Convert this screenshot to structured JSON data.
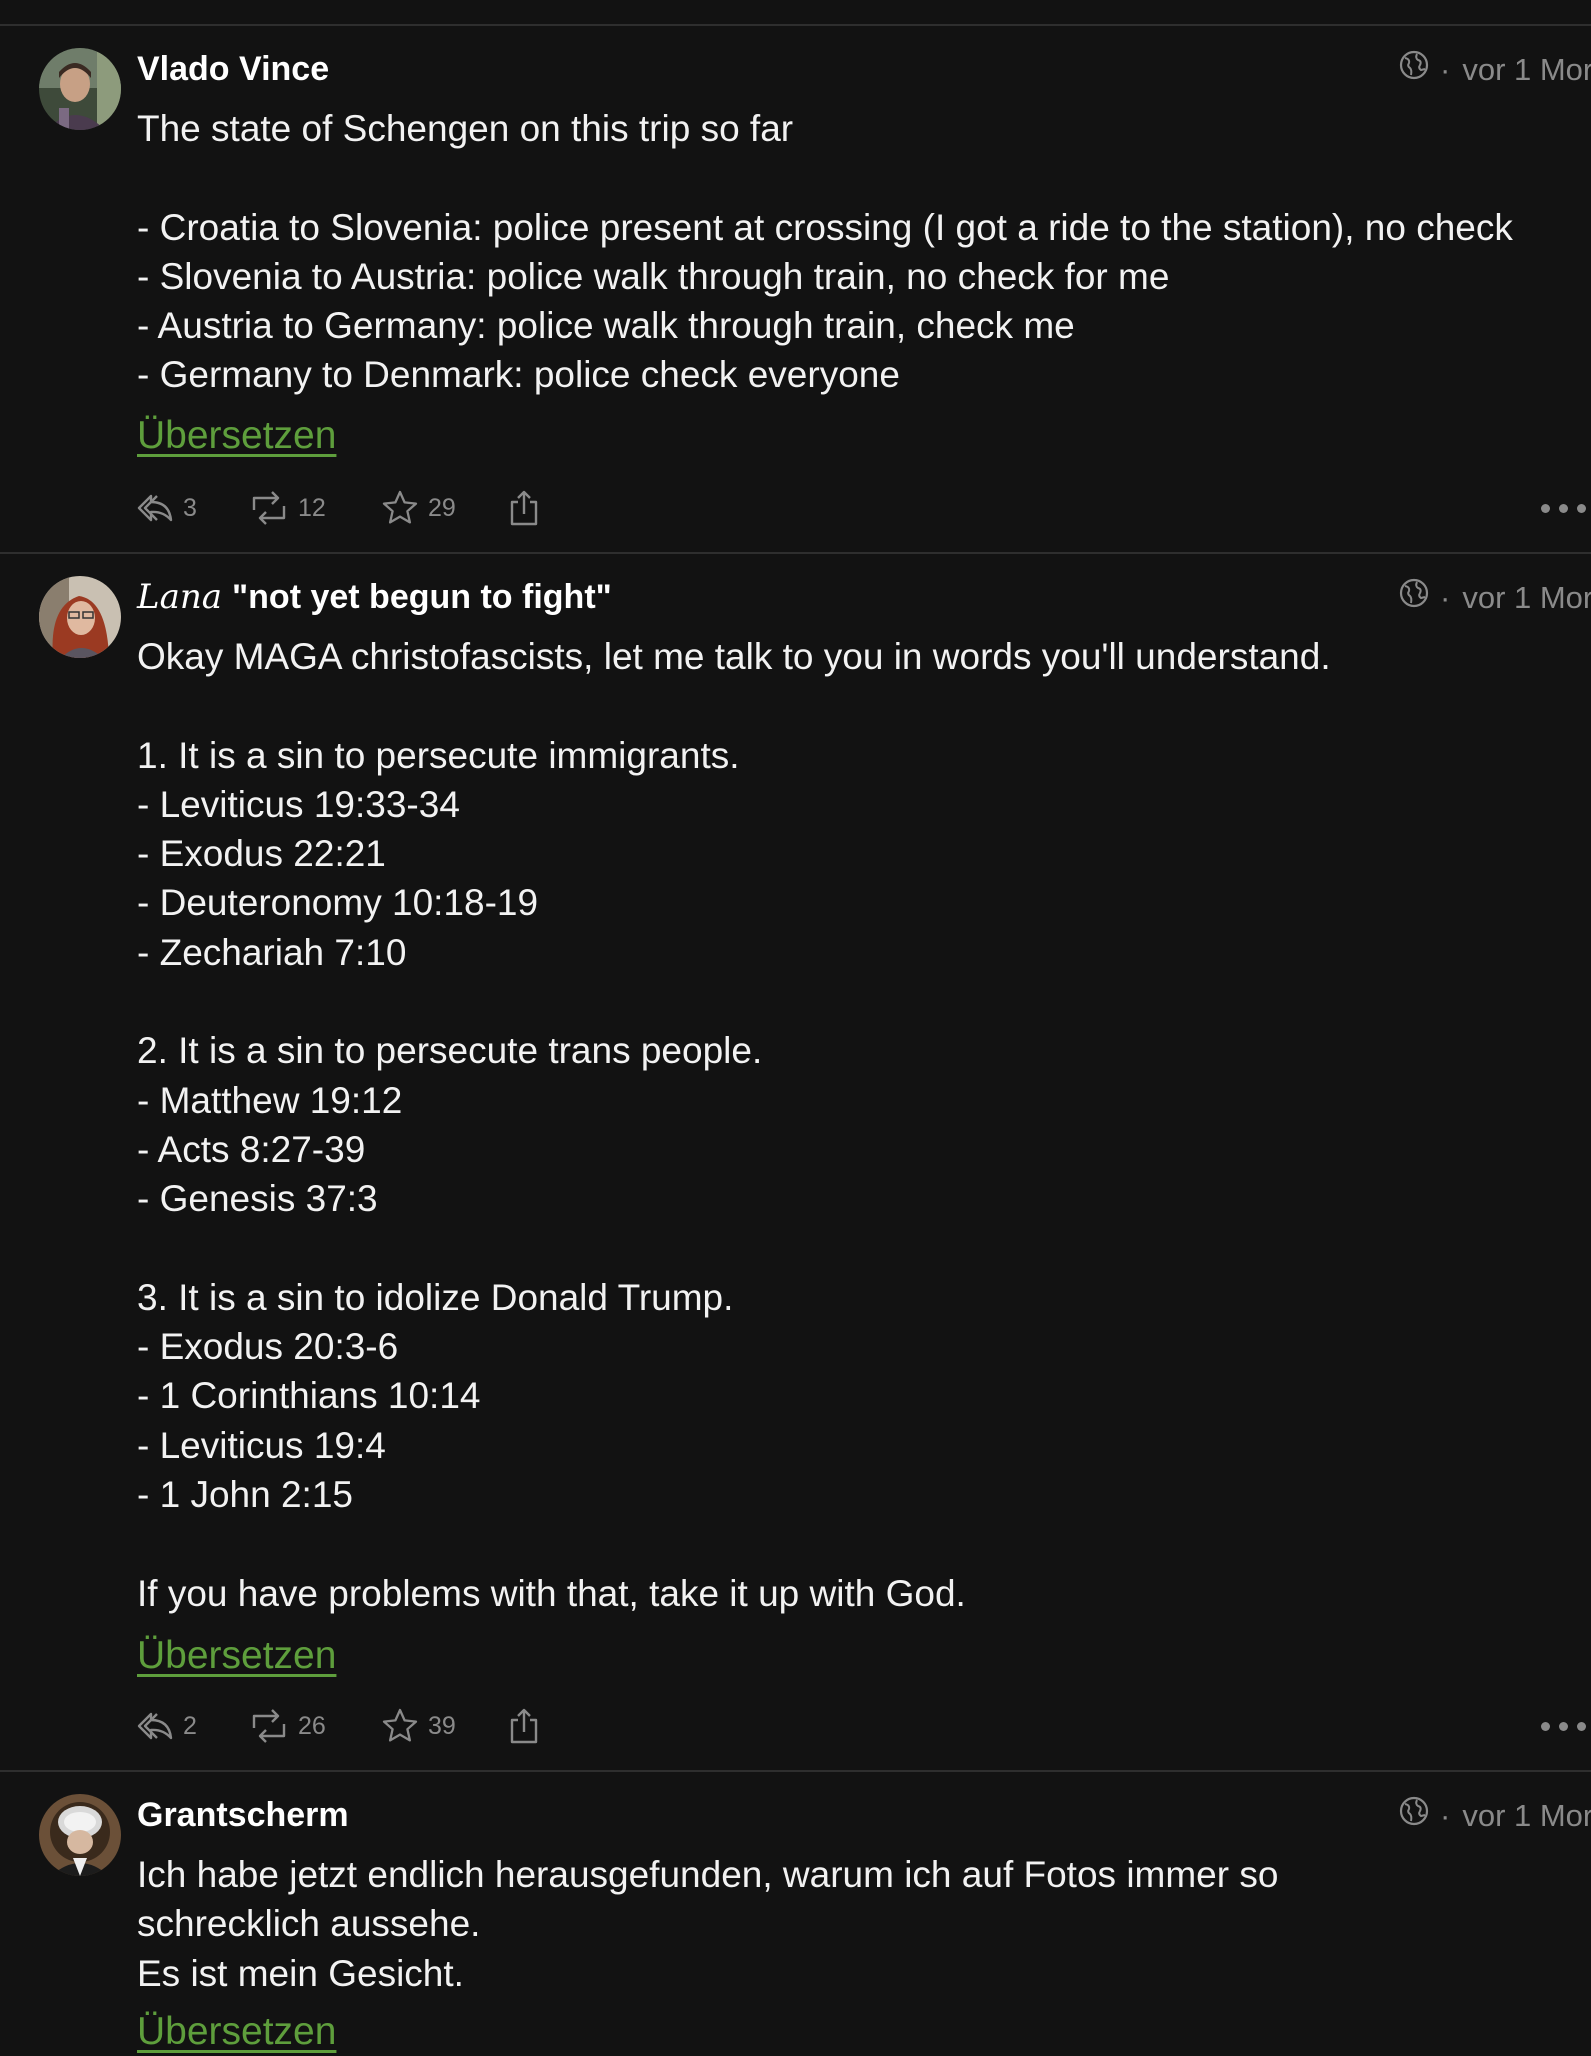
{
  "posts": [
    {
      "author_script": "",
      "author": "Vlado Vince",
      "visibility_icon": "globe-icon",
      "time": "vor 1 Mor",
      "content": "The state of Schengen on this trip so far\n\n- Croatia to Slovenia: police present at crossing (I got a ride to the station), no check\n- Slovenia to Austria: police walk through train, no check for me\n- Austria to Germany: police walk through train, check me\n- Germany to Denmark: police check everyone",
      "translate": "Übersetzen",
      "replies": "3",
      "boosts": "12",
      "favourites": "29"
    },
    {
      "author_script": "Lana",
      "author": "\"not yet begun to fight\"",
      "visibility_icon": "globe-icon",
      "time": "vor 1 Mor",
      "content": "Okay MAGA christofascists, let me talk to you in words you'll understand.\n\n1. It is a sin to persecute immigrants.\n- Leviticus 19:33-34\n- Exodus 22:21\n- Deuteronomy 10:18-19\n- Zechariah 7:10\n\n2. It is a sin to persecute trans people.\n- Matthew 19:12\n- Acts 8:27-39\n- Genesis 37:3\n\n3. It is a sin to idolize Donald Trump.\n- Exodus 20:3-6\n- 1 Corinthians 10:14\n- Leviticus 19:4\n- 1 John 2:15\n\nIf you have problems with that, take it up with God.",
      "translate": "Übersetzen",
      "replies": "2",
      "boosts": "26",
      "favourites": "39"
    },
    {
      "author_script": "",
      "author": "Grantscherm",
      "visibility_icon": "globe-icon",
      "time": "vor 1 Mor",
      "content": "Ich habe jetzt endlich herausgefunden, warum ich auf Fotos immer so\nschrecklich aussehe.\nEs ist mein Gesicht.",
      "translate": "Übersetzen"
    }
  ],
  "colors": {
    "background": "#121212",
    "text": "#f2f2f2",
    "muted": "#8a8a8a",
    "link": "#5e9e3c",
    "divider": "#2e2e2e"
  }
}
